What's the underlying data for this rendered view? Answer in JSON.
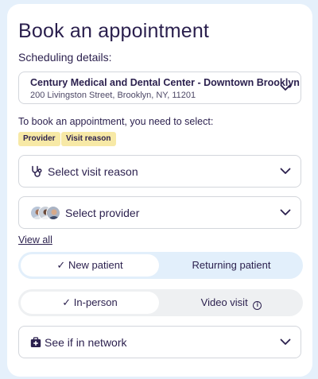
{
  "page": {
    "title": "Book an appointment",
    "subtitle": "Scheduling details:"
  },
  "location": {
    "name": "Century Medical and Dental Center - Downtown Brooklyn",
    "address": "200 Livingston Street, Brooklyn, NY, 11201"
  },
  "requirements": {
    "hint": "To book an appointment, you need to select:",
    "tags": [
      "Provider",
      "Visit reason"
    ]
  },
  "visit_reason": {
    "label": "Select visit reason",
    "icon": "stethoscope-icon"
  },
  "provider": {
    "label": "Select provider",
    "icon": "provider-avatars"
  },
  "view_all": "View all",
  "patient_type": {
    "options": [
      "New patient",
      "Returning patient"
    ],
    "selected": "New patient",
    "check": "✓"
  },
  "visit_mode": {
    "options": [
      "In-person",
      "Video visit"
    ],
    "selected": "In-person",
    "check": "✓",
    "info_glyph": "i"
  },
  "network": {
    "label": "See if in network",
    "icon": "medical-bag-icon"
  },
  "colors": {
    "text": "#2a1f4d",
    "tag_bg": "#f7e9a6",
    "page_bg": "#e5f0fb",
    "patient_toggle_bg": "#e2effb",
    "mode_toggle_bg": "#eef0f2"
  }
}
